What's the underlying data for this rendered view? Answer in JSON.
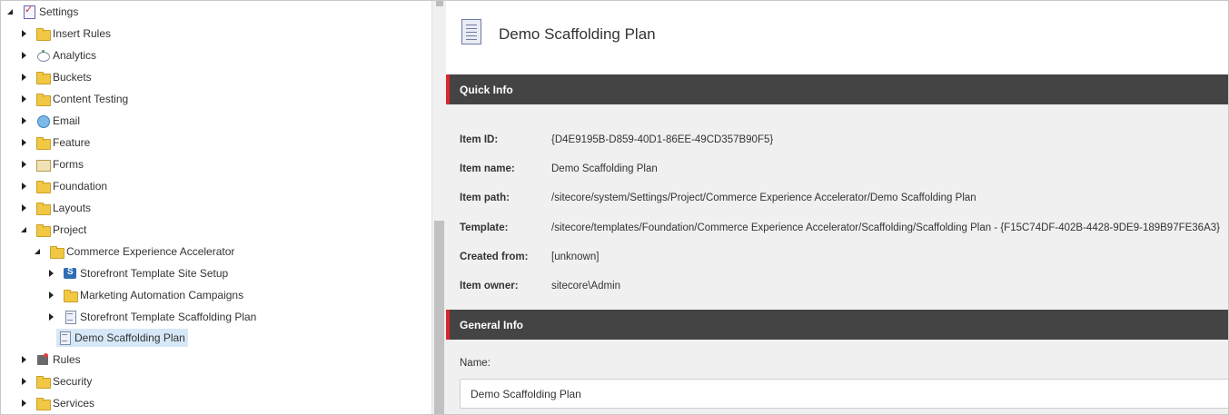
{
  "tree": {
    "items": [
      {
        "label": "Settings",
        "icon": "settings-icon"
      },
      {
        "label": "Insert Rules",
        "icon": "folder-icon"
      },
      {
        "label": "Analytics",
        "icon": "analytics-icon"
      },
      {
        "label": "Buckets",
        "icon": "folder-icon"
      },
      {
        "label": "Content Testing",
        "icon": "folder-icon"
      },
      {
        "label": "Email",
        "icon": "globe-icon"
      },
      {
        "label": "Feature",
        "icon": "folder-icon"
      },
      {
        "label": "Forms",
        "icon": "forms-icon"
      },
      {
        "label": "Foundation",
        "icon": "folder-icon"
      },
      {
        "label": "Layouts",
        "icon": "folder-icon"
      },
      {
        "label": "Project",
        "icon": "folder-icon"
      },
      {
        "label": "Commerce Experience Accelerator",
        "icon": "folder-icon"
      },
      {
        "label": "Storefront Template Site Setup",
        "icon": "site-icon"
      },
      {
        "label": "Marketing Automation Campaigns",
        "icon": "folder-icon"
      },
      {
        "label": "Storefront Template Scaffolding Plan",
        "icon": "document-icon"
      },
      {
        "label": "Demo Scaffolding Plan",
        "icon": "document-icon"
      },
      {
        "label": "Rules",
        "icon": "rules-icon"
      },
      {
        "label": "Security",
        "icon": "folder-icon"
      },
      {
        "label": "Services",
        "icon": "folder-icon"
      }
    ]
  },
  "header": {
    "title": "Demo Scaffolding Plan"
  },
  "quick_info": {
    "title": "Quick Info",
    "rows": [
      {
        "key": "Item ID:",
        "value": "{D4E9195B-D859-40D1-86EE-49CD357B90F5}"
      },
      {
        "key": "Item name:",
        "value": "Demo Scaffolding Plan"
      },
      {
        "key": "Item path:",
        "value": "/sitecore/system/Settings/Project/Commerce Experience Accelerator/Demo Scaffolding Plan"
      },
      {
        "key": "Template:",
        "value": "/sitecore/templates/Foundation/Commerce Experience Accelerator/Scaffolding/Scaffolding Plan - {F15C74DF-402B-4428-9DE9-189B97FE36A3}"
      },
      {
        "key": "Created from:",
        "value": "[unknown]"
      },
      {
        "key": "Item owner:",
        "value": "sitecore\\Admin"
      }
    ]
  },
  "general_info": {
    "title": "General Info",
    "name_label": "Name:",
    "name_value": "Demo Scaffolding Plan"
  },
  "colors": {
    "section_bar": "#444444",
    "section_accent": "#d9272e",
    "selected_row": "#d6e8f7",
    "panel_bg": "#f0f0f0"
  }
}
